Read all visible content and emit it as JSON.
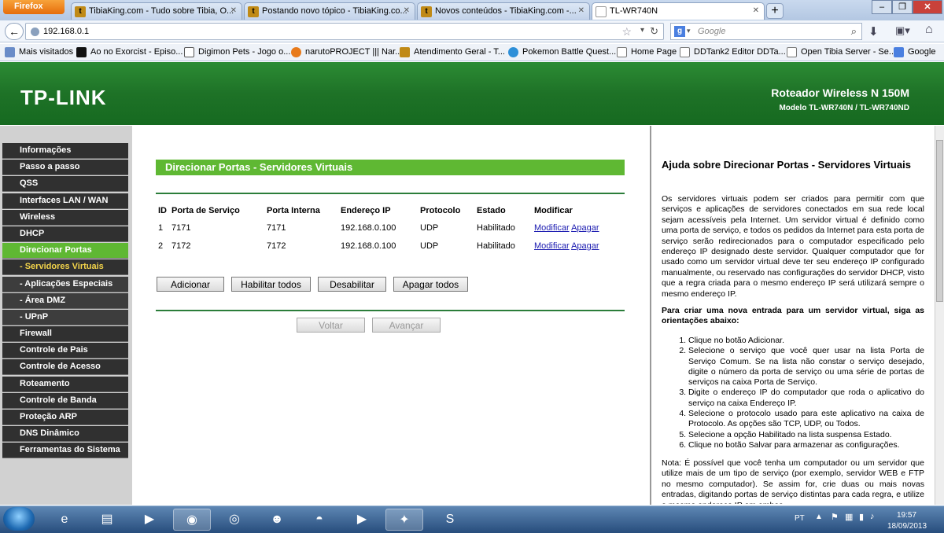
{
  "browser": {
    "menu_button": "Firefox",
    "tabs": [
      {
        "label": "TibiaKing.com - Tudo sobre Tibia, O..."
      },
      {
        "label": "Postando novo tópico - TibiaKing.co..."
      },
      {
        "label": "Novos conteúdos - TibiaKing.com -..."
      },
      {
        "label": "TL-WR740N"
      }
    ],
    "url": "192.168.0.1",
    "search_placeholder": "Google",
    "bookmarks": [
      {
        "label": "Mais visitados"
      },
      {
        "label": "Ao no Exorcist - Episo..."
      },
      {
        "label": "Digimon Pets - Jogo o..."
      },
      {
        "label": "narutoPROJECT ||| Nar..."
      },
      {
        "label": "Atendimento Geral - T..."
      },
      {
        "label": "Pokemon Battle Quest..."
      },
      {
        "label": "Home Page"
      },
      {
        "label": "DDTank2 Editor DDTa..."
      },
      {
        "label": "Open Tibia Server - Se..."
      },
      {
        "label": "Google"
      }
    ]
  },
  "header": {
    "logo": "TP-LINK",
    "model_title": "Roteador Wireless N 150M",
    "model_sub": "Modelo TL-WR740N / TL-WR740ND"
  },
  "menu": [
    {
      "label": "Informações"
    },
    {
      "label": "Passo a passo"
    },
    {
      "label": "QSS"
    },
    {
      "label": "Interfaces LAN / WAN"
    },
    {
      "label": "Wireless"
    },
    {
      "label": "DHCP"
    },
    {
      "label": "Direcionar Portas"
    },
    {
      "label": "- Servidores Virtuais"
    },
    {
      "label": "- Aplicações Especiais"
    },
    {
      "label": "- Área DMZ"
    },
    {
      "label": "- UPnP"
    },
    {
      "label": "Firewall"
    },
    {
      "label": "Controle de Pais"
    },
    {
      "label": "Controle de Acesso"
    },
    {
      "label": "Roteamento"
    },
    {
      "label": "Controle de Banda"
    },
    {
      "label": "Proteção ARP"
    },
    {
      "label": "DNS Dinâmico"
    },
    {
      "label": "Ferramentas do Sistema"
    }
  ],
  "main": {
    "title": "Direcionar Portas - Servidores Virtuais",
    "columns": [
      "ID",
      "Porta de Serviço",
      "Porta Interna",
      "Endereço IP",
      "Protocolo",
      "Estado",
      "Modificar"
    ],
    "rows": [
      {
        "id": "1",
        "service_port": "7171",
        "internal_port": "7171",
        "ip": "192.168.0.100",
        "protocol": "UDP",
        "status": "Habilitado",
        "modify": "Modificar",
        "delete": "Apagar"
      },
      {
        "id": "2",
        "service_port": "7172",
        "internal_port": "7172",
        "ip": "192.168.0.100",
        "protocol": "UDP",
        "status": "Habilitado",
        "modify": "Modificar",
        "delete": "Apagar"
      }
    ],
    "buttons": {
      "add": "Adicionar",
      "enable_all": "Habilitar todos",
      "disable_all": "Desabilitar",
      "delete_all": "Apagar todos",
      "back": "Voltar",
      "next": "Avançar"
    }
  },
  "help": {
    "title": "Ajuda sobre Direcionar Portas - Servidores Virtuais",
    "intro": "Os servidores virtuais podem ser criados para permitir com que serviços e aplicações de servidores conectados em sua rede local sejam acessíveis pela Internet. Um servidor virtual é definido como uma porta de serviço, e todos os pedidos da Internet para esta porta de serviço serão redirecionados para o computador especificado pelo endereço IP designado deste servidor. Qualquer computador que for usado como um servidor virtual deve ter seu endereço IP configurado manualmente, ou reservado nas configurações do servidor DHCP, visto que a regra criada para o mesmo endereço IP será utilizará sempre o mesmo endereço IP.",
    "steps_title": "Para criar uma nova entrada para um servidor virtual, siga as orientações abaixo:",
    "steps": [
      "Clique no botão Adicionar.",
      "Selecione o serviço que você quer usar na lista Porta de Serviço Comum. Se na lista não constar o serviço desejado, digite o número da porta de serviço ou uma série de portas de serviços na caixa Porta de Serviço.",
      "Digite o endereço IP do computador que roda o aplicativo do serviço na caixa Endereço IP.",
      "Selecione o protocolo usado para este aplicativo na caixa de Protocolo. As opções são TCP, UDP, ou Todos.",
      "Selecione a opção Habilitado na lista suspensa Estado.",
      "Clique no botão Salvar para armazenar as configurações."
    ],
    "note": "Nota: É possível que você tenha um computador ou um servidor que utilize mais de um tipo de serviço (por exemplo, servidor WEB e FTP no mesmo computador). Se assim for, crie duas ou mais novas entradas, digitando portas de serviço distintas para cada regra, e utilize o mesmo endereço IP em ambas."
  },
  "taskbar": {
    "lang": "PT",
    "time": "19:57",
    "date": "18/09/2013"
  }
}
